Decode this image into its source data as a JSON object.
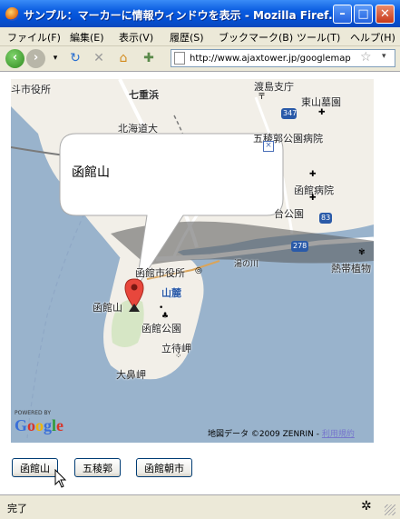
{
  "window": {
    "title": "サンプル：マーカーに情報ウィンドウを表示 - Mozilla Firef…"
  },
  "menu": [
    "ファイル(F)",
    "編集(E)",
    "表示(V)",
    "履歴(S)",
    "ブックマーク(B)",
    "ツール(T)",
    "ヘルプ(H)"
  ],
  "toolbar": {
    "url": "http://www.ajaxtower.jp/googlemap"
  },
  "map": {
    "labels": {
      "city_hall_top": "斗市役所",
      "shichijugahama": "七重浜",
      "oshima": "渡島支庁",
      "higashiyama": "東山墓園",
      "hokkaido_univ": "北海道大",
      "route347": "347",
      "hospital_muni": "五稜郭公園病院",
      "hospital_city": "函館病院",
      "daishi": "台公園",
      "route83": "83",
      "route278": "278",
      "yunokawa": "湯の川",
      "botanical": "熱帯植物",
      "hakodate_city_office": "函館市役所",
      "hakodateyama": "函館山",
      "yamanoue": "山麓",
      "hakodate_park": "函館公園",
      "tachimachi": "立待岬",
      "obana": "大鼻岬",
      "powered": "POWERED BY",
      "copyright": "地図データ ©2009 ZENRIN -",
      "terms": "利用規約"
    },
    "infowindow": {
      "text": "函館山"
    }
  },
  "buttons": [
    "函館山",
    "五稜郭",
    "函館朝市"
  ],
  "status": {
    "text": "完了"
  }
}
